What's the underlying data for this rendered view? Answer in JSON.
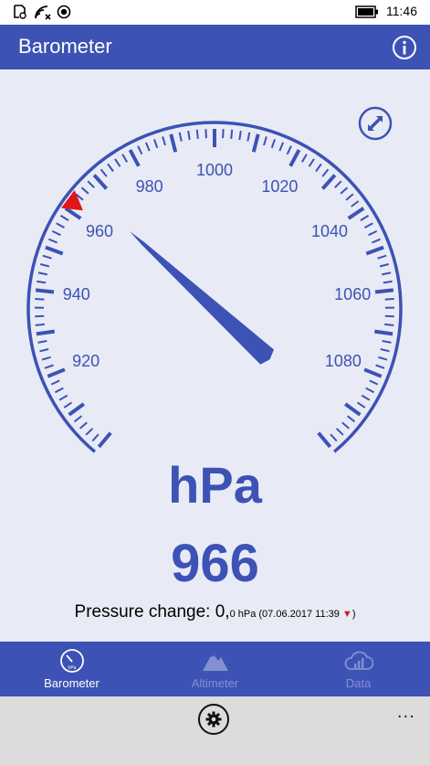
{
  "status_bar": {
    "time": "11:46",
    "icons": [
      "notification-icon",
      "wifi-icon",
      "record-icon",
      "battery-icon"
    ]
  },
  "app": {
    "title": "Barometer",
    "info_icon": "info-icon",
    "accent_color": "#3d52b5",
    "background_color": "#e8ebf5"
  },
  "gauge": {
    "min": 900,
    "max": 1100,
    "start_angle_deg": 220,
    "end_angle_deg": 500,
    "labels": [
      920,
      940,
      960,
      980,
      1000,
      1020,
      1040,
      1060,
      1080
    ],
    "needle_value": 966,
    "marker_value": 962,
    "marker_color": "#e0161b",
    "expand_icon": "expand-icon"
  },
  "reading": {
    "unit": "hPa",
    "value": "966",
    "change_label": "Pressure change: ",
    "change_value": "0,",
    "change_detail": "0 hPa (07.06.2017 11:39 ",
    "change_arrow": "▼",
    "change_close": ")"
  },
  "tabs": [
    {
      "label": "Barometer",
      "icon": "gauge-icon",
      "active": true
    },
    {
      "label": "Altimeter",
      "icon": "mountain-icon",
      "active": false
    },
    {
      "label": "Data",
      "icon": "cloud-chart-icon",
      "active": false
    }
  ],
  "app_bar": {
    "settings_icon": "gear-icon",
    "more_label": "···"
  }
}
